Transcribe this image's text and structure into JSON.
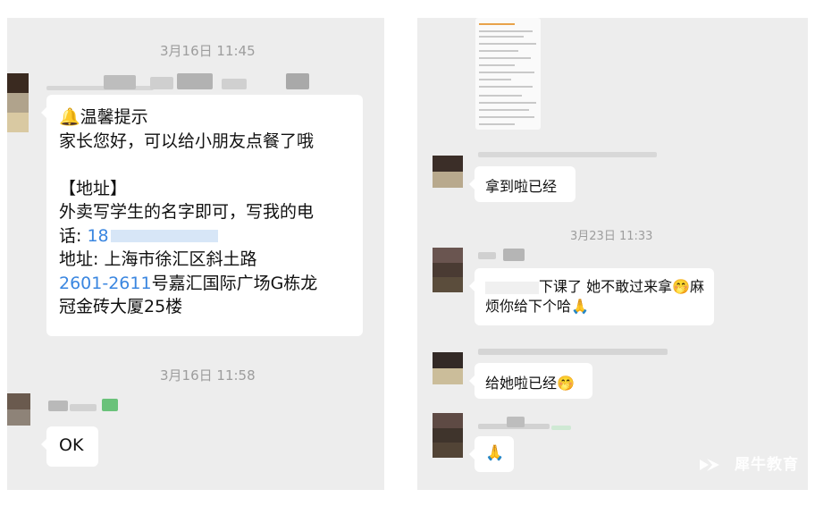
{
  "left_panel": {
    "timestamp_1": "3月16日 11:45",
    "notice": {
      "title_emoji": "🔔",
      "title": "温馨提示",
      "greeting": "家长您好，可以给小朋友点餐了哦",
      "address_header": "【地址】",
      "line_1": "外卖写学生的名字即可，写我的电",
      "line_2_prefix": "话: ",
      "line_2_phone": "18",
      "line_3": "地址: 上海市徐汇区斜土路",
      "line_4_link": "2601-2611",
      "line_4_rest": "号嘉汇国际广场G栋龙",
      "line_5": "冠金砖大厦25楼"
    },
    "timestamp_2": "3月16日 11:58",
    "reply": "OK"
  },
  "right_panel": {
    "msg_1": "拿到啦已经",
    "timestamp": "3月23日 11:33",
    "msg_2_line_1": "下课了 她不敢过来拿",
    "msg_2_emoji_1": "🤭",
    "msg_2_line_1_end": "麻",
    "msg_2_line_2": "烦你给下个哈",
    "msg_2_emoji_2": "🙏",
    "msg_3": "给她啦已经",
    "msg_3_emoji": "🤭",
    "msg_4_emoji": "🙏",
    "watermark": "犀牛教育"
  }
}
